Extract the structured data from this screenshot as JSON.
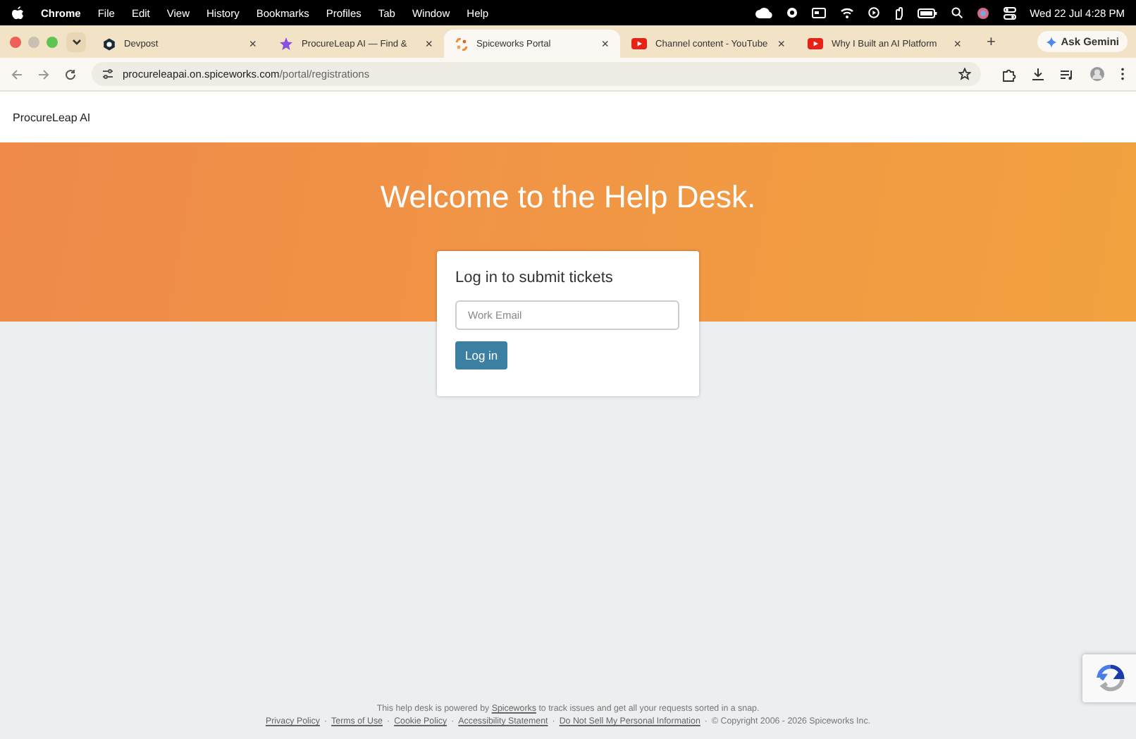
{
  "menubar": {
    "app": "Chrome",
    "menus": [
      "File",
      "Edit",
      "View",
      "History",
      "Bookmarks",
      "Profiles",
      "Tab",
      "Window",
      "Help"
    ],
    "clock": "Wed 22 Jul  4:28 PM"
  },
  "tabs": [
    {
      "title": "Devpost",
      "kind": "devpost",
      "selected": false
    },
    {
      "title": "ProcureLeap AI — Find &",
      "kind": "star",
      "selected": false
    },
    {
      "title": "Spiceworks Portal",
      "kind": "spiceworks",
      "selected": true
    },
    {
      "title": "Channel content - YouTube",
      "kind": "youtube",
      "selected": false
    },
    {
      "title": "Why I Built an AI Platform",
      "kind": "youtube",
      "selected": false
    }
  ],
  "new_tab": "+",
  "close_mark": "×",
  "gemini_button": "Ask Gemini",
  "address": {
    "host": "procureleapai.on.spiceworks.com",
    "path": "/portal/registrations"
  },
  "site_name": "ProcureLeap AI",
  "hero_title": "Welcome to the Help Desk.",
  "login_card": {
    "title": "Log in to submit tickets",
    "email": {
      "placeholder": "Work Email"
    },
    "button": "Log in"
  },
  "footer": {
    "powered_before": "This help desk is powered by ",
    "powered_link": "Spiceworks",
    "powered_after": " to track issues and get all your requests sorted in a snap.",
    "links": [
      "Privacy Policy",
      "Terms of Use",
      "Cookie Policy",
      "Accessibility Statement",
      "Do Not Sell My Personal Information"
    ],
    "separator": "·",
    "copyright": "© Copyright 2006 - 2026 Spiceworks Inc."
  }
}
